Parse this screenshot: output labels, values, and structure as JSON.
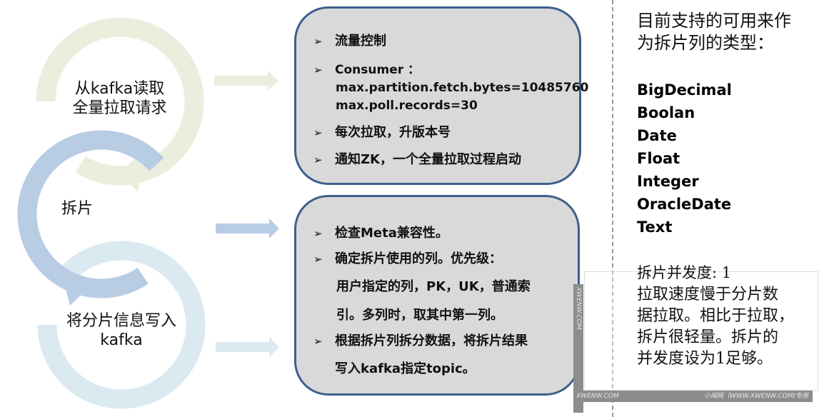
{
  "colors": {
    "stage1": "#ebeedd",
    "stage2": "#b8cce4",
    "stage3": "#dbe9f1",
    "box_fill": "#d9d9d9",
    "box_border": "#3d5f8c"
  },
  "stages": [
    {
      "label_line1": "从kafka读取",
      "label_line2": "全量拉取请求"
    },
    {
      "label_line1": "拆片",
      "label_line2": ""
    },
    {
      "label_line1": "将分片信息写入",
      "label_line2": "kafka"
    }
  ],
  "box1": {
    "items": [
      {
        "bullet": "➢",
        "text": "流量控制"
      },
      {
        "bullet": "➢",
        "text": "Consumer ："
      },
      {
        "bullet": "",
        "text": "max.partition.fetch.bytes=10485760"
      },
      {
        "bullet": "",
        "text": "max.poll.records=30"
      },
      {
        "bullet": "➢",
        "text": "每次拉取，升版本号"
      },
      {
        "bullet": "➢",
        "text": "通知ZK，一个全量拉取过程启动"
      }
    ]
  },
  "box2": {
    "items": [
      {
        "bullet": "➢",
        "text": "检查Meta兼容性。"
      },
      {
        "bullet": "➢",
        "text": "确定拆片使用的列。优先级："
      },
      {
        "bullet": "",
        "text": "用户指定的列，PK，UK，普通索"
      },
      {
        "bullet": "",
        "text": "引。多列时，取其中第一列。"
      },
      {
        "bullet": "➢",
        "text": "根据拆片列拆分数据，将拆片结果"
      },
      {
        "bullet": "",
        "text": "写入kafka指定topic。"
      }
    ]
  },
  "side": {
    "title_line1": "目前支持的可用来作",
    "title_line2": "为拆片列的类型：",
    "types": [
      "BigDecimal",
      "Boolan",
      "Date",
      "Float",
      "Integer",
      "OracleDate",
      "Text"
    ],
    "note_title": "拆片并发度: 1",
    "note_lines": [
      "拉取速度慢于分片数",
      "据拉取。相比于拉取，",
      "拆片很轻量。拆片的",
      "并发度设为1足够。"
    ]
  },
  "watermark": {
    "side_text": "XWENW.COM",
    "bottom_left": "XWENW.COM",
    "bottom_right": "小闻网（WWW.XWENW.COM)专用"
  }
}
